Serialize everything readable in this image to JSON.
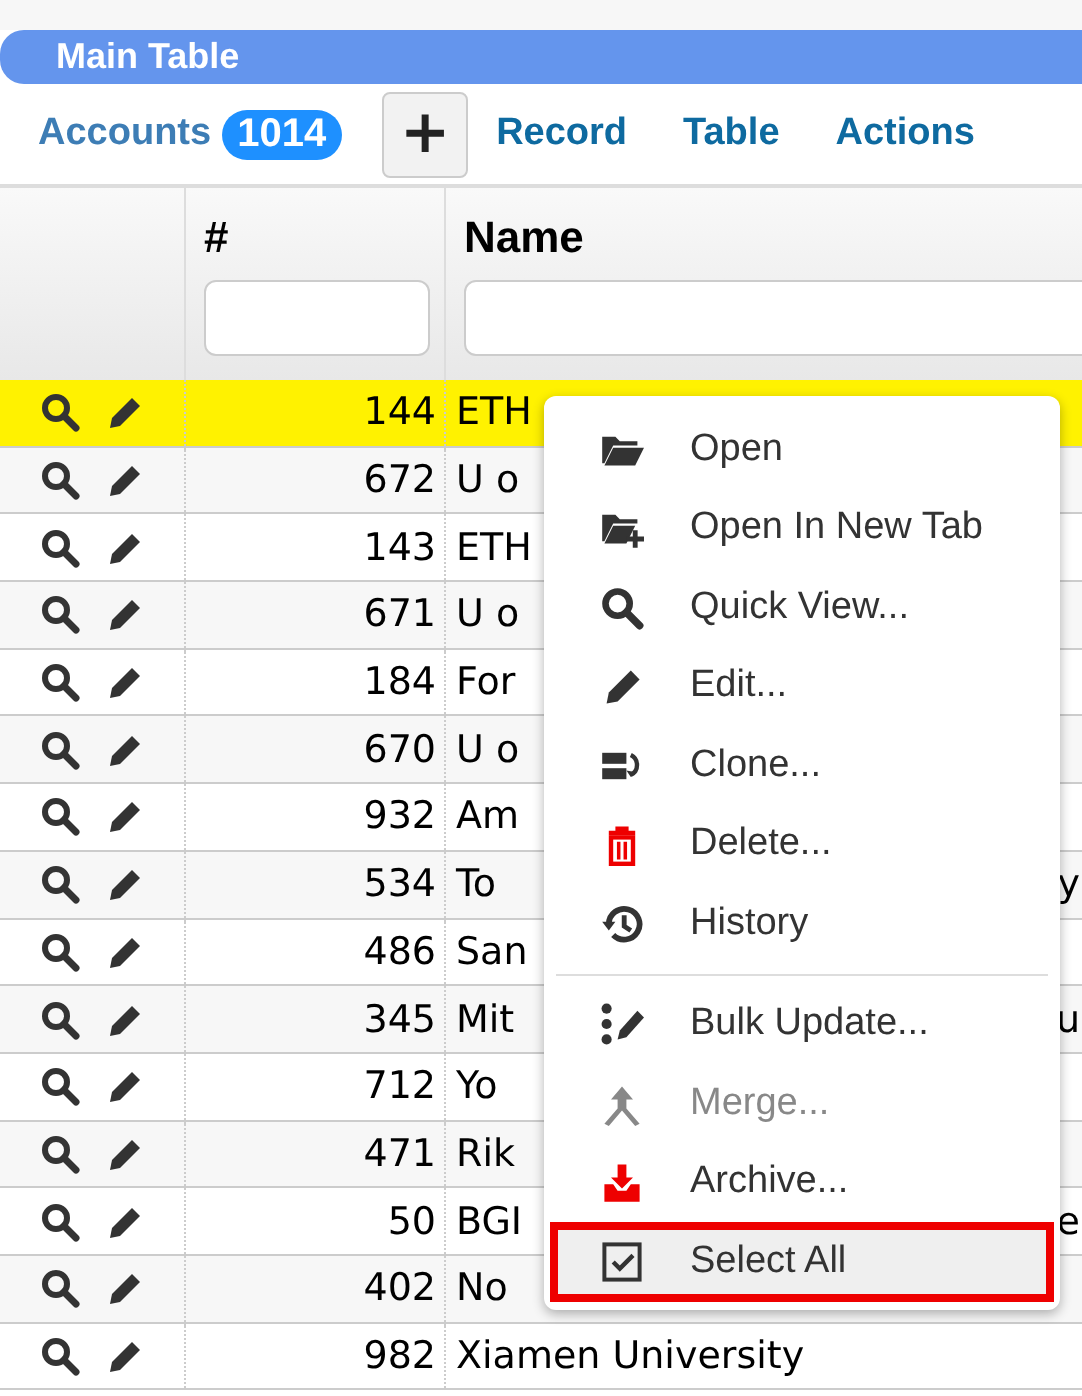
{
  "panel": {
    "title": "Main Table"
  },
  "toolbar": {
    "entity": "Accounts",
    "count": "1014",
    "add_label": "+",
    "menus": [
      "Record",
      "Table",
      "Actions"
    ]
  },
  "table": {
    "columns": [
      "#",
      "Name"
    ],
    "rows": [
      {
        "id": "144",
        "name": "ETH",
        "tail": "",
        "selected": true
      },
      {
        "id": "672",
        "name": "U o",
        "tail": "",
        "selected": false
      },
      {
        "id": "143",
        "name": "ETH",
        "tail": "",
        "selected": false
      },
      {
        "id": "671",
        "name": "U o",
        "tail": "",
        "selected": false
      },
      {
        "id": "184",
        "name": "For",
        "tail": "",
        "selected": false
      },
      {
        "id": "670",
        "name": "U o",
        "tail": "",
        "selected": false
      },
      {
        "id": "932",
        "name": "Am",
        "tail": "",
        "selected": false
      },
      {
        "id": "534",
        "name": "To",
        "tail": "y",
        "selected": false
      },
      {
        "id": "486",
        "name": "San",
        "tail": "",
        "selected": false
      },
      {
        "id": "345",
        "name": "Mit",
        "tail": "u",
        "selected": false
      },
      {
        "id": "712",
        "name": "Yo",
        "tail": "",
        "selected": false
      },
      {
        "id": "471",
        "name": "Rik",
        "tail": "",
        "selected": false
      },
      {
        "id": "50",
        "name": "BGI",
        "tail": "e",
        "selected": false
      },
      {
        "id": "402",
        "name": "No",
        "tail": "",
        "selected": false
      },
      {
        "id": "982",
        "name": "Xiamen University",
        "tail": "",
        "selected": false
      }
    ]
  },
  "context_menu": {
    "groups": [
      [
        {
          "label": "Open",
          "disabled": false,
          "highlighted": false
        },
        {
          "label": "Open In New Tab",
          "disabled": false,
          "highlighted": false
        },
        {
          "label": "Quick View...",
          "disabled": false,
          "highlighted": false
        },
        {
          "label": "Edit...",
          "disabled": false,
          "highlighted": false
        },
        {
          "label": "Clone...",
          "disabled": false,
          "highlighted": false
        },
        {
          "label": "Delete...",
          "disabled": false,
          "highlighted": false
        },
        {
          "label": "History",
          "disabled": false,
          "highlighted": false
        }
      ],
      [
        {
          "label": "Bulk Update...",
          "disabled": false,
          "highlighted": false
        },
        {
          "label": "Merge...",
          "disabled": true,
          "highlighted": false
        },
        {
          "label": "Archive...",
          "disabled": false,
          "highlighted": false
        },
        {
          "label": "Select All",
          "disabled": false,
          "highlighted": true
        }
      ]
    ]
  }
}
